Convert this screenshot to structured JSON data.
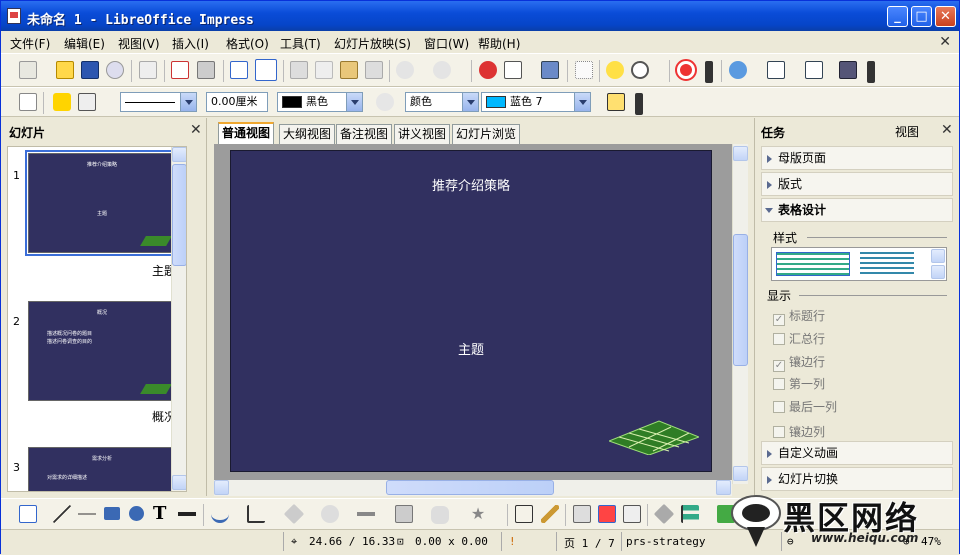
{
  "window": {
    "title": "未命名 1 - LibreOffice Impress"
  },
  "menu": [
    "文件(F)",
    "编辑(E)",
    "视图(V)",
    "插入(I)",
    "格式(O)",
    "工具(T)",
    "幻灯片放映(S)",
    "窗口(W)",
    "帮助(H)"
  ],
  "format_bar": {
    "line_width": "0.00厘米",
    "line_color": "黑色",
    "area_style": "颜色",
    "area_color": "蓝色 7",
    "line_color_hex": "#000000",
    "area_color_hex": "#00b8ff"
  },
  "slides_pane": {
    "title": "幻灯片",
    "slides": [
      {
        "number": "1",
        "label": "主题",
        "title": "推荐介绍策略",
        "sub": "主题"
      },
      {
        "number": "2",
        "label": "概况",
        "title": "概况",
        "bullets": [
          "描述概况问卷的题目",
          "描述问卷调查的目的"
        ]
      },
      {
        "number": "3",
        "label": "",
        "title": "需求分析",
        "bullets": [
          "对需求的详细描述"
        ]
      }
    ]
  },
  "view_tabs": [
    "普通视图",
    "大纲视图",
    "备注视图",
    "讲义视图",
    "幻灯片浏览"
  ],
  "slide": {
    "title": "推荐介绍策略",
    "subtitle": "主题",
    "background": "#313060"
  },
  "task_pane": {
    "title": "任务",
    "view_label": "视图",
    "sections": [
      "母版页面",
      "版式",
      "表格设计",
      "自定义动画",
      "幻灯片切换"
    ],
    "styles_label": "样式",
    "display_label": "显示",
    "options": [
      {
        "label": "标题行",
        "checked": true
      },
      {
        "label": "汇总行",
        "checked": false
      },
      {
        "label": "镶边行",
        "checked": true
      },
      {
        "label": "第一列",
        "checked": false
      },
      {
        "label": "最后一列",
        "checked": false
      },
      {
        "label": "镶边列",
        "checked": false
      }
    ]
  },
  "status": {
    "position": "24.66 / 16.33",
    "size": "0.00 x 0.00",
    "page": "页 1 / 7",
    "master": "prs-strategy",
    "zoom": "47%"
  },
  "watermark": {
    "brand": "黑区网络",
    "url": "www.heiqu.com"
  },
  "colors": {
    "titlebar": "#0a4cd8",
    "slide_bg": "#313060",
    "accent": "#f0a830"
  }
}
